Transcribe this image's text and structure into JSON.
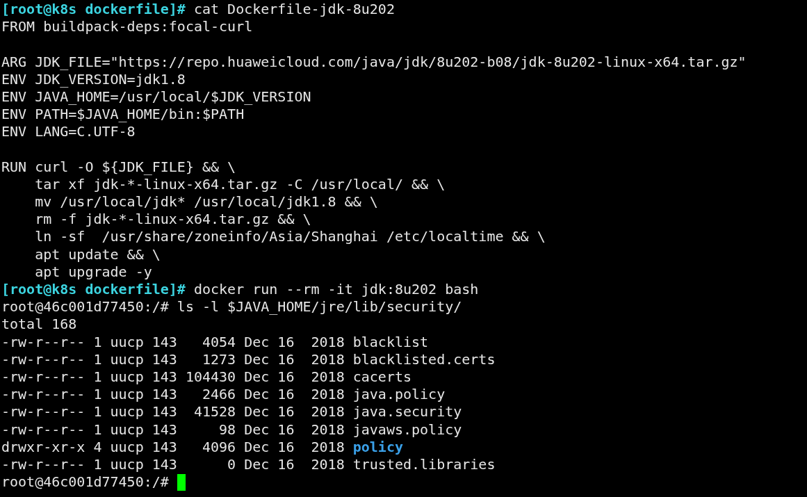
{
  "terminal": {
    "lines": [
      {
        "kind": "prompt",
        "prompt": "[root@k8s dockerfile]#",
        "command": "cat Dockerfile-jdk-8u202"
      },
      {
        "kind": "text",
        "text": "FROM buildpack-deps:focal-curl"
      },
      {
        "kind": "blank"
      },
      {
        "kind": "text",
        "text": "ARG JDK_FILE=\"https://repo.huaweicloud.com/java/jdk/8u202-b08/jdk-8u202-linux-x64.tar.gz\""
      },
      {
        "kind": "text",
        "text": "ENV JDK_VERSION=jdk1.8"
      },
      {
        "kind": "text",
        "text": "ENV JAVA_HOME=/usr/local/$JDK_VERSION"
      },
      {
        "kind": "text",
        "text": "ENV PATH=$JAVA_HOME/bin:$PATH"
      },
      {
        "kind": "text",
        "text": "ENV LANG=C.UTF-8"
      },
      {
        "kind": "blank"
      },
      {
        "kind": "text",
        "text": "RUN curl -O ${JDK_FILE} && \\"
      },
      {
        "kind": "text",
        "text": "    tar xf jdk-*-linux-x64.tar.gz -C /usr/local/ && \\"
      },
      {
        "kind": "text",
        "text": "    mv /usr/local/jdk* /usr/local/jdk1.8 && \\"
      },
      {
        "kind": "text",
        "text": "    rm -f jdk-*-linux-x64.tar.gz && \\"
      },
      {
        "kind": "text",
        "text": "    ln -sf  /usr/share/zoneinfo/Asia/Shanghai /etc/localtime && \\"
      },
      {
        "kind": "text",
        "text": "    apt update && \\"
      },
      {
        "kind": "text",
        "text": "    apt upgrade -y"
      },
      {
        "kind": "prompt",
        "prompt": "[root@k8s dockerfile]#",
        "command": "docker run --rm -it jdk:8u202 bash"
      },
      {
        "kind": "shell",
        "prompt": "root@46c001d77450:/#",
        "command": "ls -l $JAVA_HOME/jre/lib/security/",
        "cursor": false
      },
      {
        "kind": "text",
        "text": "total 168"
      },
      {
        "kind": "file",
        "info": "-rw-r--r-- 1 uucp 143   4054 Dec 16  2018",
        "name": "blacklist",
        "directory": false
      },
      {
        "kind": "file",
        "info": "-rw-r--r-- 1 uucp 143   1273 Dec 16  2018",
        "name": "blacklisted.certs",
        "directory": false
      },
      {
        "kind": "file",
        "info": "-rw-r--r-- 1 uucp 143 104430 Dec 16  2018",
        "name": "cacerts",
        "directory": false
      },
      {
        "kind": "file",
        "info": "-rw-r--r-- 1 uucp 143   2466 Dec 16  2018",
        "name": "java.policy",
        "directory": false
      },
      {
        "kind": "file",
        "info": "-rw-r--r-- 1 uucp 143  41528 Dec 16  2018",
        "name": "java.security",
        "directory": false
      },
      {
        "kind": "file",
        "info": "-rw-r--r-- 1 uucp 143     98 Dec 16  2018",
        "name": "javaws.policy",
        "directory": false
      },
      {
        "kind": "file",
        "info": "drwxr-xr-x 4 uucp 143   4096 Dec 16  2018",
        "name": "policy",
        "directory": true
      },
      {
        "kind": "file",
        "info": "-rw-r--r-- 1 uucp 143      0 Dec 16  2018",
        "name": "trusted.libraries",
        "directory": false
      },
      {
        "kind": "shell",
        "prompt": "root@46c001d77450:/#",
        "cursor": true
      }
    ]
  }
}
